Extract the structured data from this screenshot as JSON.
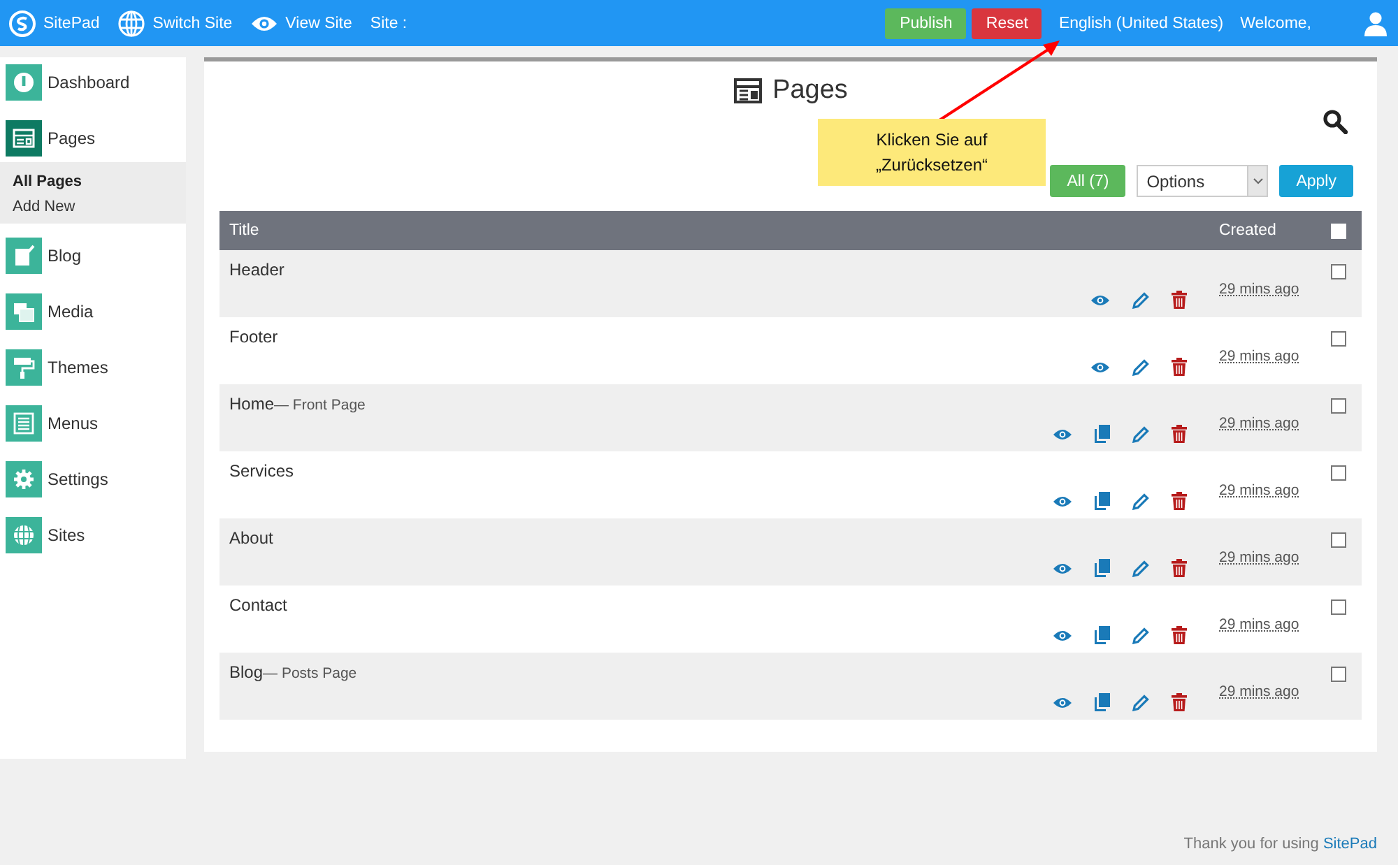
{
  "topbar": {
    "brand": "SitePad",
    "switch_site": "Switch Site",
    "view_site": "View Site",
    "site_label": "Site :",
    "publish": "Publish",
    "reset": "Reset",
    "language": "English (United States)",
    "welcome": "Welcome,"
  },
  "sidebar": {
    "items": [
      {
        "label": "Dashboard",
        "selected": false
      },
      {
        "label": "Pages",
        "selected": true,
        "children": [
          {
            "label": "All Pages",
            "selected": true
          },
          {
            "label": "Add New",
            "selected": false
          }
        ]
      },
      {
        "label": "Blog",
        "selected": false
      },
      {
        "label": "Media",
        "selected": false
      },
      {
        "label": "Themes",
        "selected": false
      },
      {
        "label": "Menus",
        "selected": false
      },
      {
        "label": "Settings",
        "selected": false
      },
      {
        "label": "Sites",
        "selected": false
      }
    ]
  },
  "page": {
    "title": "Pages",
    "filter": "All (7)",
    "bulk_select": {
      "value": "Options"
    },
    "apply": "Apply"
  },
  "callout": {
    "text_lines": [
      "Klicken Sie auf",
      "„Zurücksetzen“"
    ]
  },
  "table": {
    "columns": [
      "Title",
      "Created"
    ],
    "select_all": false,
    "rows": [
      {
        "title": "Header",
        "can_duplicate": false,
        "created": "29 mins ago",
        "checked": false
      },
      {
        "title": "Footer",
        "can_duplicate": false,
        "created": "29 mins ago",
        "checked": false
      },
      {
        "title": "Home",
        "suffix": "— Front Page",
        "can_duplicate": true,
        "created": "29 mins ago",
        "checked": false
      },
      {
        "title": "Services",
        "can_duplicate": true,
        "created": "29 mins ago",
        "checked": false
      },
      {
        "title": "About",
        "can_duplicate": true,
        "created": "29 mins ago",
        "checked": false
      },
      {
        "title": "Contact",
        "can_duplicate": true,
        "created": "29 mins ago",
        "checked": false
      },
      {
        "title": "Blog",
        "suffix": "— Posts Page",
        "can_duplicate": true,
        "created": "29 mins ago",
        "checked": false
      }
    ]
  },
  "footer": {
    "text": "Thank you for using",
    "link": "SitePad"
  }
}
